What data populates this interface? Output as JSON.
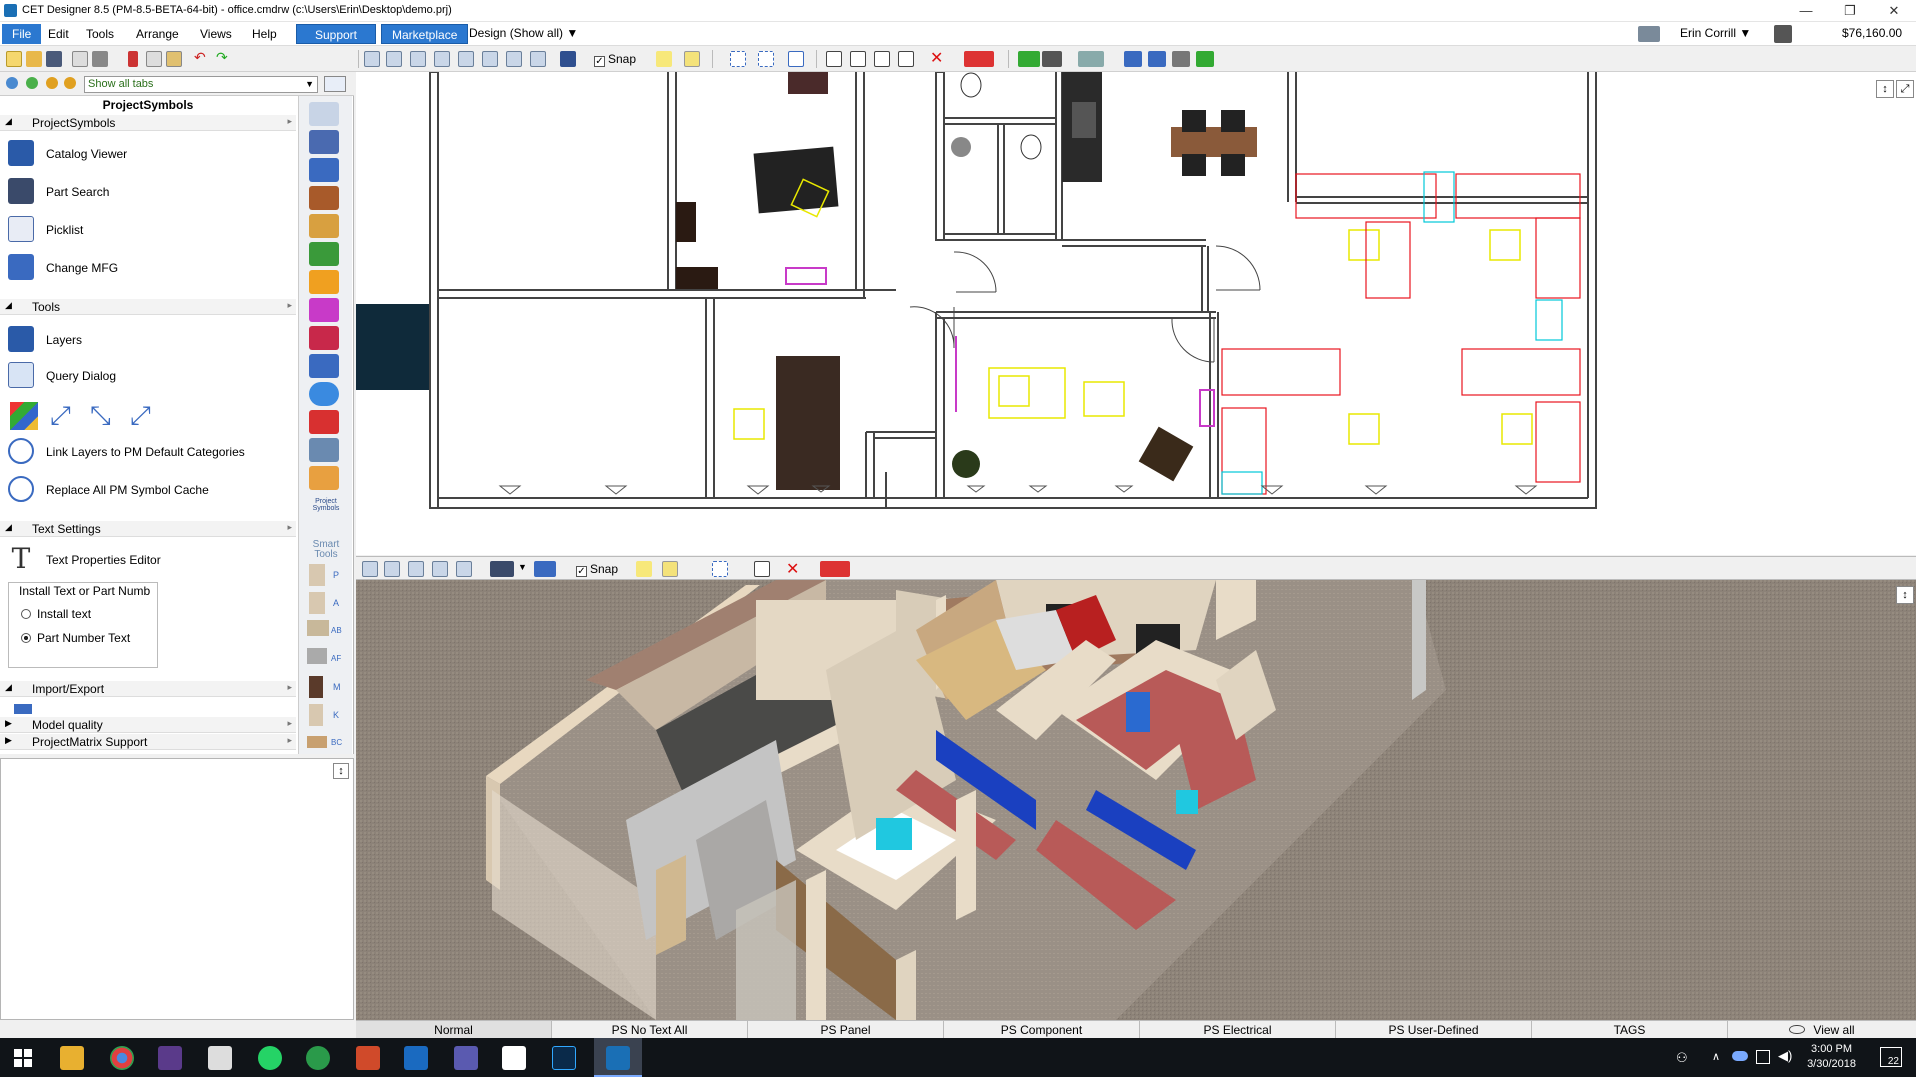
{
  "window": {
    "title": "CET Designer 8.5 (PM-8.5-BETA-64-bit) - office.cmdrw (c:\\Users\\Erin\\Desktop\\demo.prj)",
    "minimize": "—",
    "restore": "❐",
    "close": "✕"
  },
  "menubar": {
    "items": [
      "File",
      "Edit",
      "Tools",
      "Arrange",
      "Views",
      "Help"
    ],
    "support": "Support",
    "marketplace": "Marketplace",
    "design_mode": "Design (Show all)",
    "user": "Erin Corrill",
    "price": "$76,160.00"
  },
  "toolbar": {
    "snap_label": "Snap"
  },
  "left_panel": {
    "tabs_select": "Show all tabs",
    "panel_title": "ProjectSymbols",
    "sections": {
      "project_symbols": "ProjectSymbols",
      "tools": "Tools",
      "text_settings": "Text Settings",
      "import_export": "Import/Export",
      "model_quality": "Model quality",
      "pm_support": "ProjectMatrix Support"
    },
    "project_items": [
      "Catalog Viewer",
      "Part Search",
      "Picklist",
      "Change MFG"
    ],
    "tool_items": {
      "layers": "Layers",
      "query_dialog": "Query Dialog",
      "link_layers": "Link Layers to PM Default Categories",
      "replace_cache": "Replace All PM Symbol Cache"
    },
    "text_items": {
      "editor": "Text Properties Editor",
      "group_label": "Install Text or Part Numb",
      "radio_install": "Install text",
      "radio_part": "Part Number Text"
    },
    "icon_column_labels": {
      "project_symbols": "Project Symbols",
      "smart_tools": "Smart Tools",
      "letters": [
        "P",
        "A",
        "AB",
        "AF",
        "M",
        "K",
        "BC"
      ]
    }
  },
  "view3d_toolbar": {
    "snap_label": "Snap"
  },
  "statusbar": {
    "tabs": [
      "Normal",
      "PS No Text All",
      "PS Panel",
      "PS Component",
      "PS Electrical",
      "PS User-Defined",
      "TAGS",
      "View all"
    ]
  },
  "taskbar": {
    "time": "3:00 PM",
    "date": "3/30/2018",
    "notifications": "22"
  },
  "colors": {
    "accent": "#2b78d0",
    "plan_red": "#e8141e",
    "plan_yellow": "#e8e800",
    "plan_cyan": "#00c8d8",
    "floor_carpet": "#8a8076"
  }
}
